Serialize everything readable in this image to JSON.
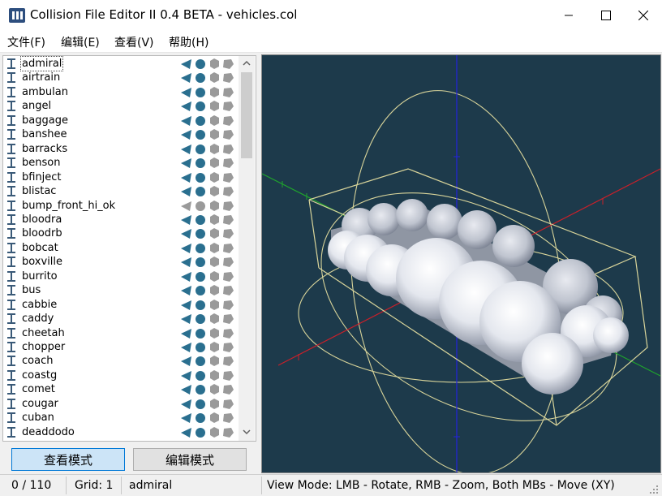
{
  "window": {
    "title": "Collision File Editor II 0.4 BETA - vehicles.col"
  },
  "menu": [
    "文件(F)",
    "编辑(E)",
    "查看(V)",
    "帮助(H)"
  ],
  "models": [
    {
      "name": "admiral",
      "enabled": true
    },
    {
      "name": "airtrain",
      "enabled": true
    },
    {
      "name": "ambulan",
      "enabled": true
    },
    {
      "name": "angel",
      "enabled": true
    },
    {
      "name": "baggage",
      "enabled": true
    },
    {
      "name": "banshee",
      "enabled": true
    },
    {
      "name": "barracks",
      "enabled": true
    },
    {
      "name": "benson",
      "enabled": true
    },
    {
      "name": "bfinject",
      "enabled": true
    },
    {
      "name": "blistac",
      "enabled": true
    },
    {
      "name": "bump_front_hi_ok",
      "enabled": false
    },
    {
      "name": "bloodra",
      "enabled": true
    },
    {
      "name": "bloodrb",
      "enabled": true
    },
    {
      "name": "bobcat",
      "enabled": true
    },
    {
      "name": "boxville",
      "enabled": true
    },
    {
      "name": "burrito",
      "enabled": true
    },
    {
      "name": "bus",
      "enabled": true
    },
    {
      "name": "cabbie",
      "enabled": true
    },
    {
      "name": "caddy",
      "enabled": true
    },
    {
      "name": "cheetah",
      "enabled": true
    },
    {
      "name": "chopper",
      "enabled": true
    },
    {
      "name": "coach",
      "enabled": true
    },
    {
      "name": "coastg",
      "enabled": true
    },
    {
      "name": "comet",
      "enabled": true
    },
    {
      "name": "cougar",
      "enabled": true
    },
    {
      "name": "cuban",
      "enabled": true
    },
    {
      "name": "deaddodo",
      "enabled": true
    }
  ],
  "list_scroll": {
    "position": 0.0,
    "visible_fraction": 0.245
  },
  "buttons": {
    "view_mode": "查看模式",
    "edit_mode": "编辑模式"
  },
  "status": {
    "count": "0 / 110",
    "grid": "Grid: 1",
    "selected": "admiral",
    "hint": "View Mode: LMB - Rotate, RMB - Zoom, Both MBs - Move (XY)"
  },
  "colors": {
    "viewport_bg": "#1d3a4b",
    "axis_x": "#c8202a",
    "axis_y": "#1fa52c",
    "axis_z": "#2222dd",
    "bounds": "#d8d49a",
    "sphere": "#e4e7ee",
    "icon_active": "#2a6f8f",
    "icon_inactive": "#9a9a9a",
    "mode_active_bg": "#cce4f7",
    "mode_active_border": "#0078d7"
  },
  "icons": {
    "row": "model-file-icon",
    "status": [
      "arrow-icon",
      "sphere-icon",
      "box-icon",
      "mesh-icon"
    ]
  }
}
